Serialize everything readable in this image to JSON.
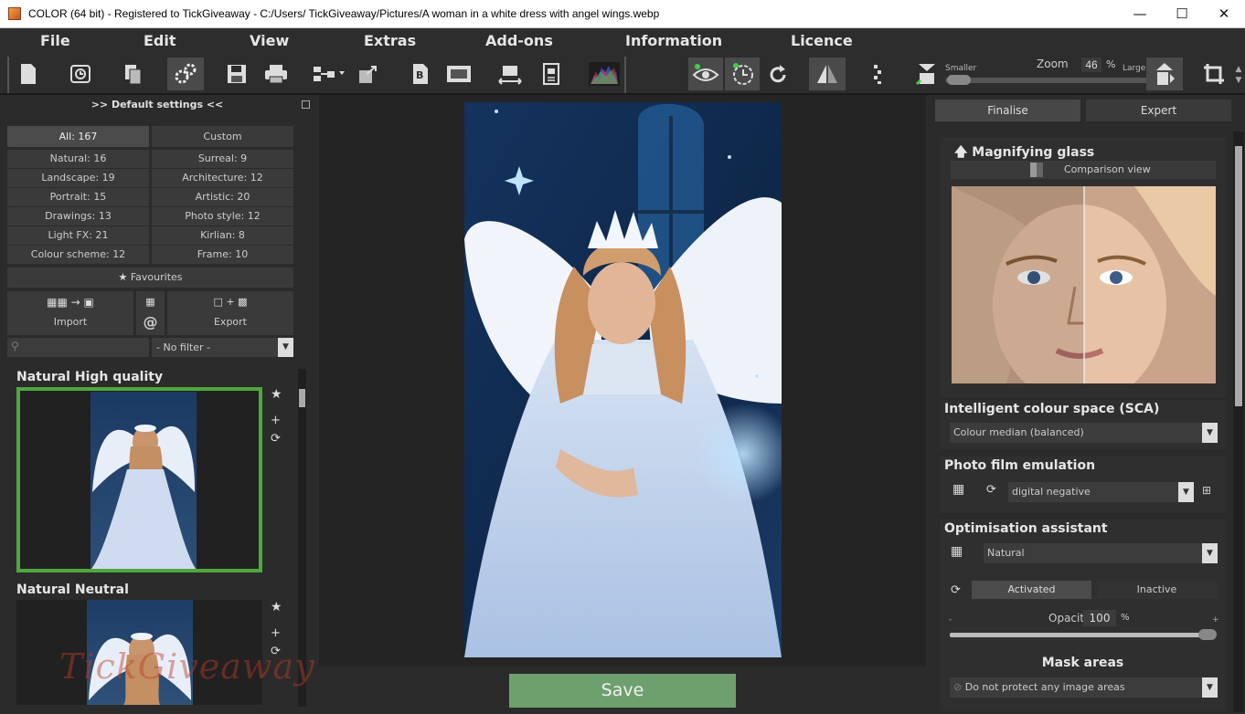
{
  "title_bar": {
    "title": "COLOR (64 bit) - Registered to TickGiveaway - C:/Users/ TickGiveaway/Pictures/A woman in a white dress with angel wings.webp",
    "minimize": "—",
    "maximize": "☐",
    "close": "✕"
  },
  "menu": [
    "File",
    "Edit",
    "View",
    "Extras",
    "Add-ons",
    "Information",
    "Licence"
  ],
  "zoom": {
    "label": "Zoom",
    "value": "46",
    "unit": "%",
    "smaller": "Smaller",
    "larger": "Larger"
  },
  "left_panel": {
    "header": ">> Default settings <<",
    "tabs": {
      "all": "All: 167",
      "custom": "Custom"
    },
    "categories": [
      [
        "Natural: 16",
        "Surreal: 9"
      ],
      [
        "Landscape: 19",
        "Architecture: 12"
      ],
      [
        "Portrait: 15",
        "Artistic: 20"
      ],
      [
        "Drawings: 13",
        "Photo style: 12"
      ],
      [
        "Light FX: 21",
        "Kirlian: 8"
      ],
      [
        "Colour scheme: 12",
        "Frame: 10"
      ]
    ],
    "favourites": "Favourites",
    "import": "Import",
    "export": "Export",
    "at_symbol": "@",
    "filter": "- No filter -",
    "presets": [
      {
        "name": "Natural High quality"
      },
      {
        "name": "Natural Neutral"
      }
    ]
  },
  "save": "Save",
  "right_panel": {
    "tabs": [
      "Finalise",
      "Expert"
    ],
    "magnifier": {
      "title": "Magnifying glass",
      "comparison": "Comparison view"
    },
    "sca": {
      "title": "Intelligent colour space (SCA)",
      "value": "Colour median (balanced)"
    },
    "film": {
      "title": "Photo film emulation",
      "value": "digital negative"
    },
    "optim": {
      "title": "Optimisation assistant",
      "value": "Natural",
      "activated": "Activated",
      "inactive": "Inactive",
      "opacity_label": "Opacity",
      "opacity": "100",
      "pct": "%",
      "minus": "-",
      "plus": "+"
    },
    "mask": {
      "title": "Mask areas",
      "value": "Do not protect any image areas"
    }
  },
  "watermark": "TickGiveaway"
}
